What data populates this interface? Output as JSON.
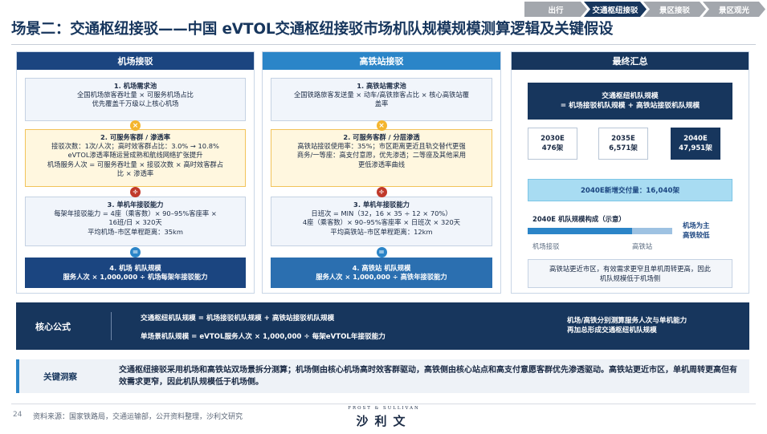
{
  "nav": {
    "tabs": [
      {
        "label": "出行",
        "active": false
      },
      {
        "label": "交通枢纽接驳",
        "active": true
      },
      {
        "label": "景区接驳",
        "active": false
      },
      {
        "label": "景区观光",
        "active": false
      }
    ]
  },
  "title": "场景二：交通枢纽接驳——中国 eVTOL交通枢纽接驳市场机队规模规模测算逻辑及关键假设",
  "airport": {
    "header": "机场接驳",
    "step1": {
      "title": "1. 机场需求池",
      "lines": [
        "全国机场旅客吞吐量 × 可服务机场占比",
        "优先覆盖千万级以上核心机场"
      ]
    },
    "op1": "×",
    "step2": {
      "title": "2. 可服务客群 / 渗透率",
      "lines": [
        "接驳次数：1次/人次；高时效客群占比：3.0% → 10.8%",
        "eVTOL渗透率随运营成熟和航线网络扩张提升",
        "机场服务人次 = 可服务吞吐量 × 接驳次数 × 高时效客群占",
        "比 × 渗透率"
      ]
    },
    "op2": "÷",
    "step3": {
      "title": "3. 单机年接驳能力",
      "lines": [
        "每架年接驳能力 = 4座（乘客数）× 90–95%客座率 ×",
        "16班/日 × 320天",
        "平均机场–市区单程距离：35km"
      ]
    },
    "op3": "=",
    "step4": {
      "title": "4. 机场 机队规模",
      "line": "服务人次 × 1,000,000 ÷ 机场每架年接驳能力"
    }
  },
  "rail": {
    "header": "高铁站接驳",
    "step1": {
      "title": "1. 高铁站需求池",
      "lines": [
        "全国铁路旅客发送量 × 动车/高铁旅客占比 × 核心高铁站覆",
        "盖率"
      ]
    },
    "op1": "×",
    "step2": {
      "title": "2. 可服务客群 / 分层渗透",
      "lines": [
        "高铁站接驳使用率：35%；市区距离更近且轨交替代更强",
        "商务/一等座：高支付意愿，优先渗透；二等座及其他采用",
        "更低渗透率曲线"
      ]
    },
    "op2": "÷",
    "step3": {
      "title": "3. 单机年接驳能力",
      "lines": [
        "日班次 = MIN（32，16 × 35 ÷ 12 × 70%）",
        "4座（乘客数）× 90–95%客座率 × 日班次 × 320天",
        "平均高铁站–市区单程距离：12km"
      ]
    },
    "op3": "=",
    "step4": {
      "title": "4. 高铁站 机队规模",
      "line": "服务人次 × 1,000,000 ÷ 高铁年接驳能力"
    }
  },
  "summary": {
    "header": "最终汇总",
    "box": {
      "title": "交通枢纽机队规模",
      "line": "= 机场接驳机队规模 + 高铁站接驳机队规模"
    },
    "years": [
      {
        "year": "2030E",
        "value": "476架"
      },
      {
        "year": "2035E",
        "value": "6,571架"
      },
      {
        "year": "2040E",
        "value": "47,951架"
      }
    ],
    "added": "2040E新增交付量：16,040架",
    "structure_label": "2040E 机队规模构成（示意）",
    "bar": {
      "airport_label": "机场接驳",
      "rail_label": "高铁站",
      "airport_share": 0.72
    },
    "bar_note": [
      "机场为主",
      "高铁较低"
    ],
    "note": [
      "高铁站更近市区，有效需求更窄且单机周转更高，因此",
      "机队规模低于机场侧"
    ]
  },
  "core": {
    "label": "核心公式",
    "formula1": "交通枢纽机队规模 = 机场接驳机队规模 + 高铁站接驳机队规模",
    "formula2": "单场景机队规模 = eVTOL服务人次 × 1,000,000 ÷ 每架eVTOL年接驳能力",
    "right": [
      "机场/高铁分别测算服务人次与单机能力",
      "再加总形成交通枢纽机队规模"
    ]
  },
  "insight": {
    "label": "关键洞察",
    "text": "交通枢纽接驳采用机场和高铁站双场景拆分测算；机场侧由核心机场高时效客群驱动，高铁侧由核心站点和高支付意愿客群优先渗透驱动。高铁站更近市区，单机周转更高但有效需求更窄，因此机队规模低于机场侧。"
  },
  "footer": {
    "page": "24",
    "source": "资料来源：国家铁路局，交通运输部，公开资料整理，沙利文研究",
    "logo_top": "FROST & SULLIVAN",
    "logo_cn": "沙利文"
  },
  "colors": {
    "navy": "#17365d",
    "blue": "#1b4580",
    "sky": "#2b85c8",
    "gold": "#f4b52f",
    "red": "#c0392b"
  }
}
